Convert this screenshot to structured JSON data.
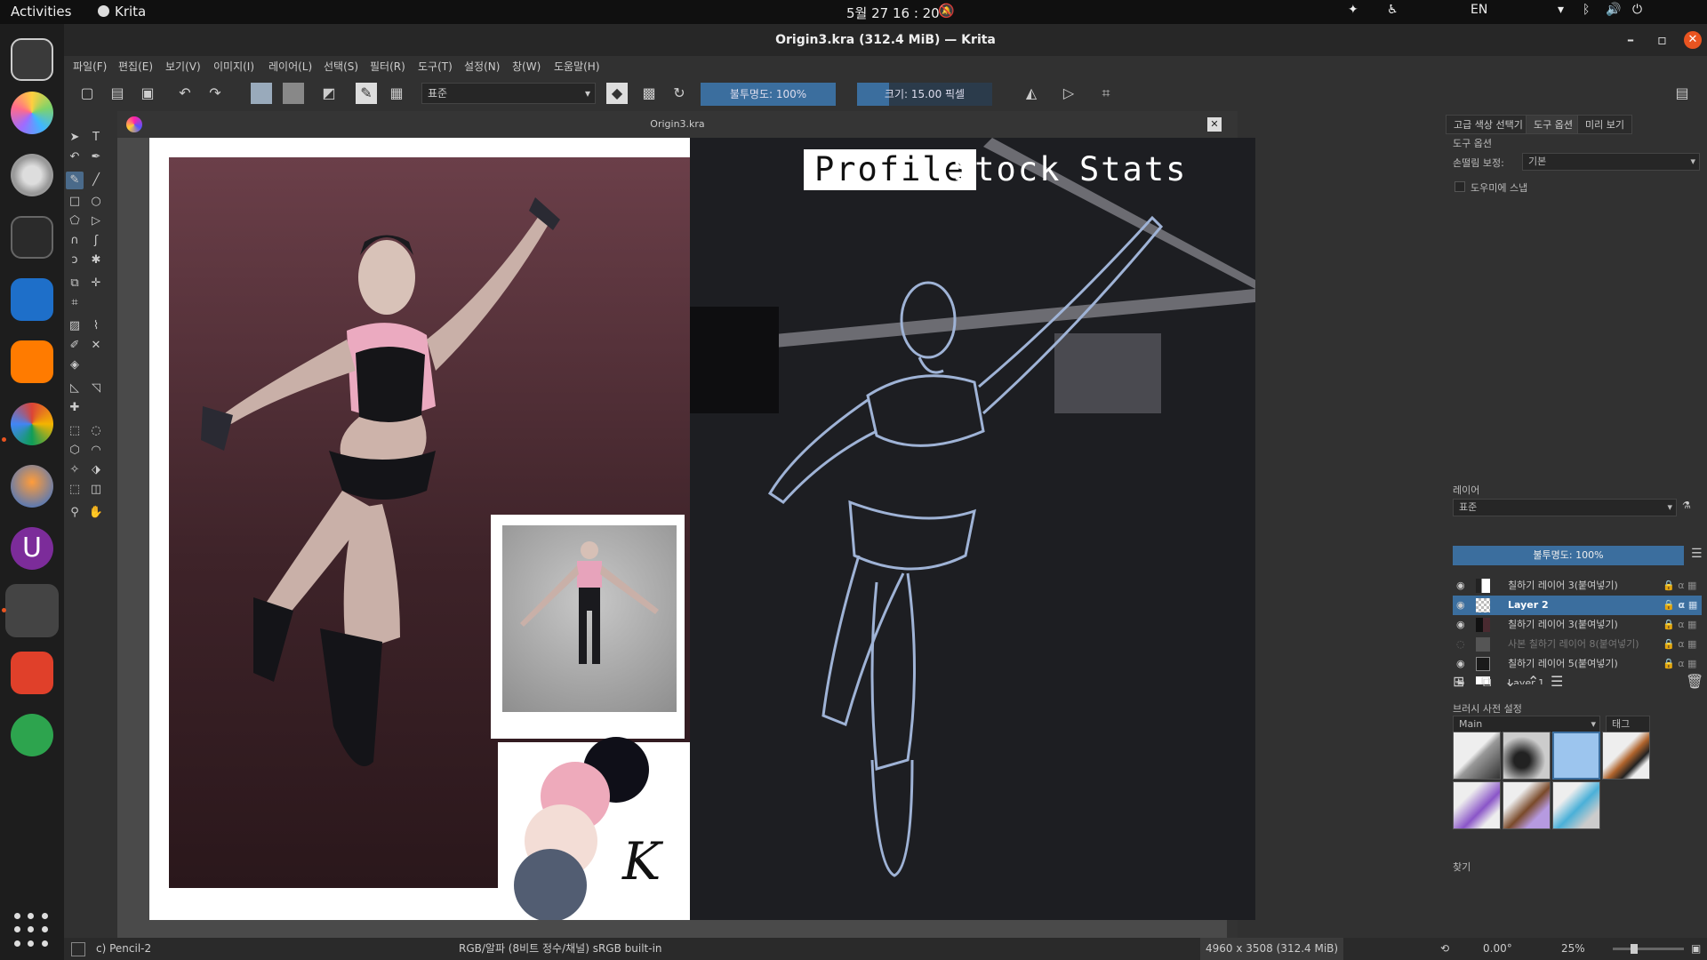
{
  "topbar": {
    "activities": "Activities",
    "app_name": "Krita",
    "clock": "5월 27  16 : 20",
    "lang": "EN"
  },
  "window": {
    "title": "Origin3.kra (312.4 MiB) — Krita"
  },
  "menu": [
    "파일(F)",
    "편집(E)",
    "보기(V)",
    "이미지(I)",
    "레이어(L)",
    "선택(S)",
    "필터(R)",
    "도구(T)",
    "설정(N)",
    "창(W)",
    "도움말(H)"
  ],
  "toolbar": {
    "blend_mode": "표준",
    "opacity": "불투명도: 100%",
    "size": "크기: 15.00 픽셀"
  },
  "document": {
    "tab_title": "Origin3.kra"
  },
  "artwork": {
    "tabs": [
      "Profile",
      "Stock",
      "Stats"
    ],
    "signature": "K"
  },
  "docker": {
    "tabs": [
      "고급 색상 선택기",
      "도구 옵션",
      "미리 보기"
    ],
    "tool_options_title": "도구 옵션",
    "smoothing_label": "손떨림 보정:",
    "smoothing_value": "기본",
    "snap_label": "도우미에 스냅",
    "layers_title": "레이어",
    "layers_blend": "표준",
    "layers_opacity": "불투명도: 100%",
    "layers": [
      {
        "name": "칠하기 레이어 3(붙여넣기)",
        "visible": true,
        "selected": false
      },
      {
        "name": "Layer 2",
        "visible": true,
        "selected": true
      },
      {
        "name": "칠하기 레이어 3(붙여넣기)",
        "visible": true,
        "selected": false
      },
      {
        "name": "사본 칠하기 레이어 8(붙여넣기)",
        "visible": false,
        "selected": false
      },
      {
        "name": "칠하기 레이어 5(붙여넣기)",
        "visible": true,
        "selected": false
      },
      {
        "name": "Layer 1",
        "visible": true,
        "selected": false
      }
    ],
    "brush_title": "브러시 사전 설정",
    "brush_tag": "Main",
    "brush_tag_btn": "태그",
    "search_label": "찾기"
  },
  "status": {
    "brush": "c) Pencil-2",
    "colorspace": "RGB/알파 (8비트 정수/채널)  sRGB built-in",
    "image_size": "4960 x 3508 (312.4 MiB)",
    "rotation": "0.00°",
    "zoom": "25%"
  },
  "colors": {
    "accent": "#3b6e9e",
    "swatch_black": "#0f0f18",
    "swatch_pink": "#eeaabb",
    "swatch_peach": "#f3ddd6",
    "swatch_slate": "#525d72",
    "close": "#e95420"
  }
}
